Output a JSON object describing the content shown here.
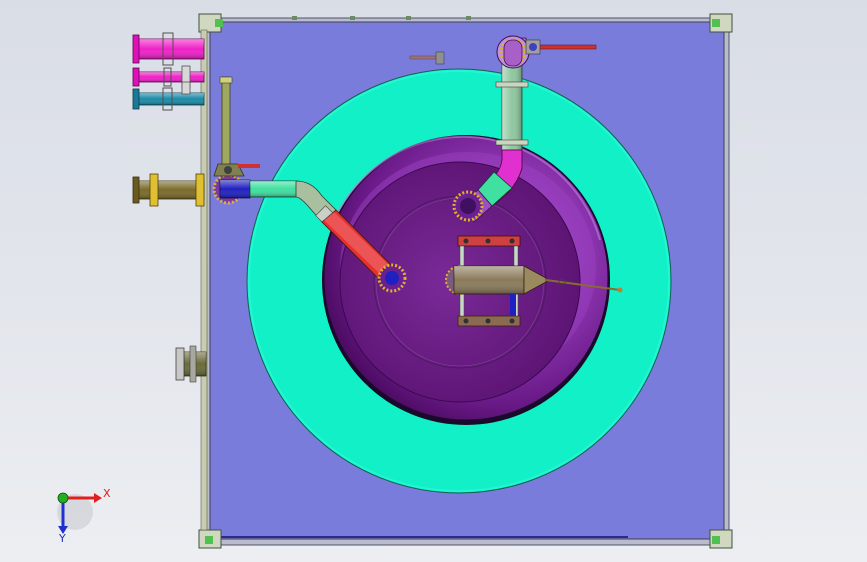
{
  "triad": {
    "x_label": "X",
    "y_label": "Y",
    "x_color": "#e02020",
    "y_color": "#2030d0",
    "z_color": "#20b020"
  },
  "colors": {
    "viewport_bg": "#e0e3ea",
    "base_plate": "#7a7cdc",
    "frame": "#9aa0b4",
    "outer_ring": "#12f0c8",
    "vessel_dark": "#5a1270",
    "vessel_mid": "#7a2a98",
    "vessel_light": "#c070e0",
    "pipe_magenta": "#f020c8",
    "pipe_teal": "#1a8aa6",
    "pipe_olive": "#7a6a2a",
    "pipe_red": "#e83030",
    "pipe_green": "#40e0a0",
    "pipe_sage": "#8ec8a0",
    "pipe_blue": "#2020c0",
    "flange": "#e0b030",
    "mechanism_body": "#8a7a5a"
  }
}
